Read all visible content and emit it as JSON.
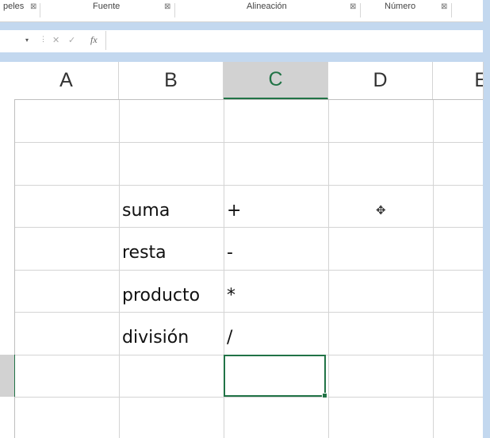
{
  "ribbon": {
    "groups": [
      {
        "label": "peles",
        "launcher": "⊠"
      },
      {
        "label": "Fuente",
        "launcher": "⊠"
      },
      {
        "label": "Alineación",
        "launcher": "⊠"
      },
      {
        "label": "Número",
        "launcher": "⊠"
      }
    ]
  },
  "formula_bar": {
    "cancel": "✕",
    "enter": "✓",
    "fx": "fx",
    "value": ""
  },
  "columns": [
    "A",
    "B",
    "C",
    "D",
    "E"
  ],
  "selected_column": "C",
  "cells": {
    "B4": "suma",
    "C4": "+",
    "B5": "resta",
    "C5": "-",
    "B6": "producto",
    "C6": "*",
    "B7": "división",
    "C7": "/"
  },
  "active_cell": "C8",
  "cursor_icon": "plus-cursor-icon"
}
